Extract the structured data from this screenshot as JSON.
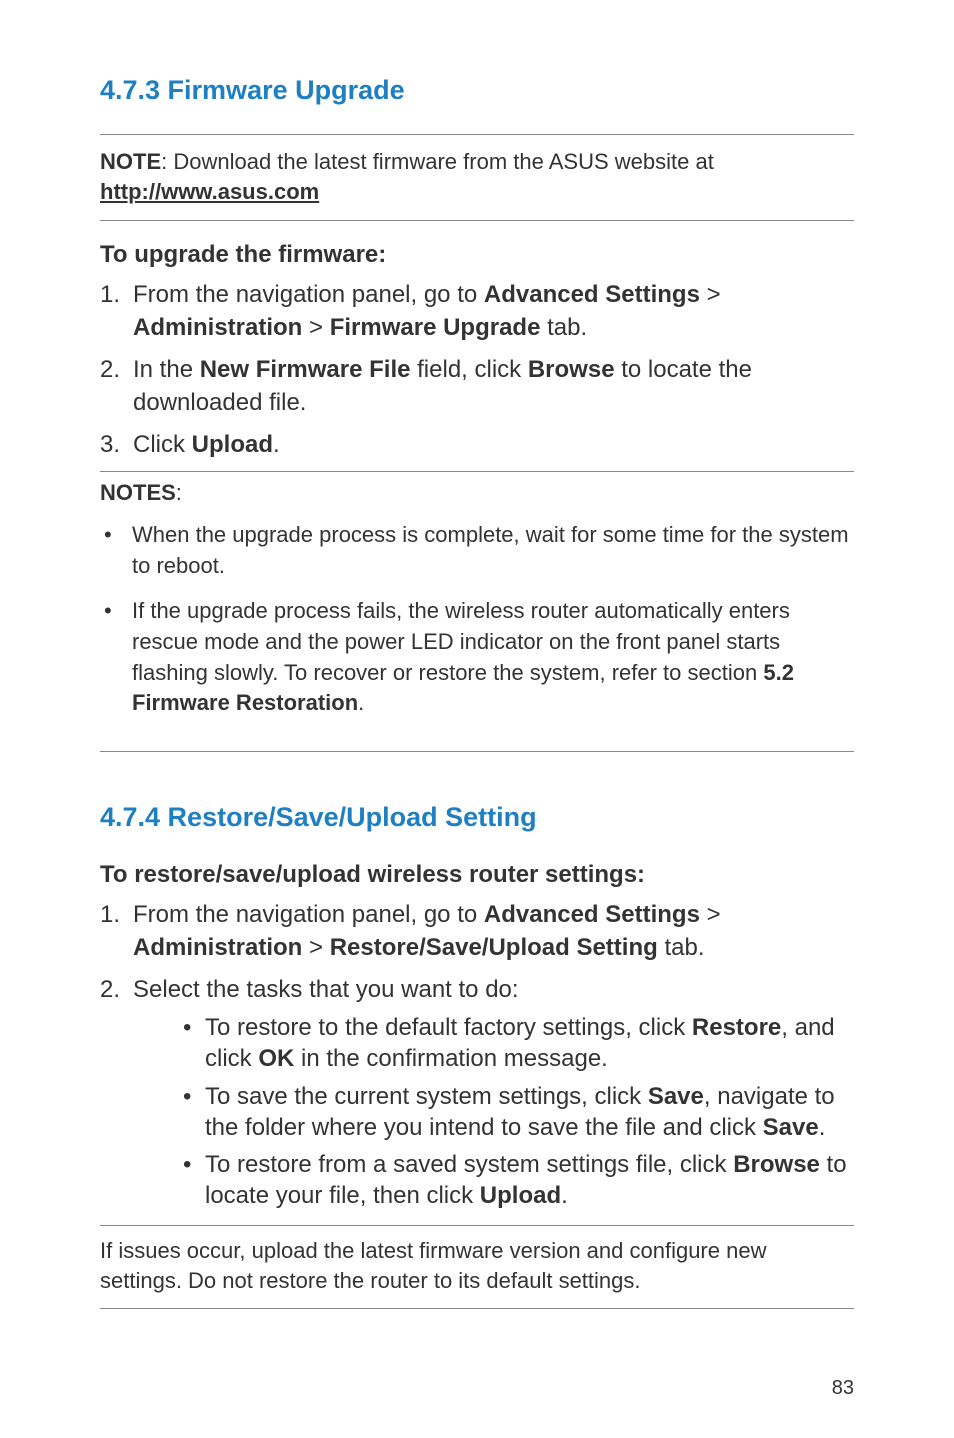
{
  "section1": {
    "heading": "4.7.3  Firmware Upgrade",
    "note_prefix": "NOTE",
    "note_text": ":  Download the latest firmware from the ASUS website at ",
    "note_link": "http://www.asus.com",
    "subheading": "To upgrade the firmware:",
    "steps": [
      {
        "pre": "From the navigation panel, go to ",
        "b1": "Advanced Settings",
        "mid1": " > ",
        "b2": "Administration",
        "mid2": " > ",
        "b3": "Firmware Upgrade",
        "post": " tab."
      },
      {
        "pre": "In the ",
        "b1": "New Firmware File",
        "mid1": " field, click ",
        "b2": "Browse",
        "post": " to locate the downloaded file."
      },
      {
        "pre": "Click ",
        "b1": "Upload",
        "post": "."
      }
    ],
    "notes_label": "NOTES",
    "notes_colon": ":",
    "notes": [
      "When the upgrade process is complete, wait for some time for the system to reboot.",
      {
        "pre": "If the upgrade process fails, the wireless router automatically enters rescue mode and the power LED indicator on the front panel starts flashing slowly. To recover or restore the system, refer to section ",
        "b1": "5.2 Firmware Restoration",
        "post": "."
      }
    ]
  },
  "section2": {
    "heading": "4.7.4  Restore/Save/Upload Setting",
    "subheading": "To restore/save/upload wireless router settings:",
    "step1": {
      "pre": "From the navigation panel, go to ",
      "b1": "Advanced Settings",
      "mid1": " > ",
      "b2": "Administration",
      "mid2": " > ",
      "b3": "Restore/Save/Upload Setting",
      "post": " tab."
    },
    "step2_text": "Select the tasks that you want to do:",
    "subitems": [
      {
        "pre": "To restore to the default factory settings, click ",
        "b1": "Restore",
        "mid1": ", and click ",
        "b2": "OK",
        "post": " in the confirmation message."
      },
      {
        "pre": "To save the current system settings, click ",
        "b1": "Save",
        "mid1": ", navigate to the folder where you intend to save the file and click ",
        "b2": "Save",
        "post": "."
      },
      {
        "pre": "To restore from a saved system settings file, click ",
        "b1": "Browse",
        "mid1": " to locate your file, then click ",
        "b2": "Upload",
        "post": "."
      }
    ],
    "footer": "If issues occur, upload the latest firmware version and configure new settings. Do not restore the router to its default settings."
  },
  "page_number": "83"
}
